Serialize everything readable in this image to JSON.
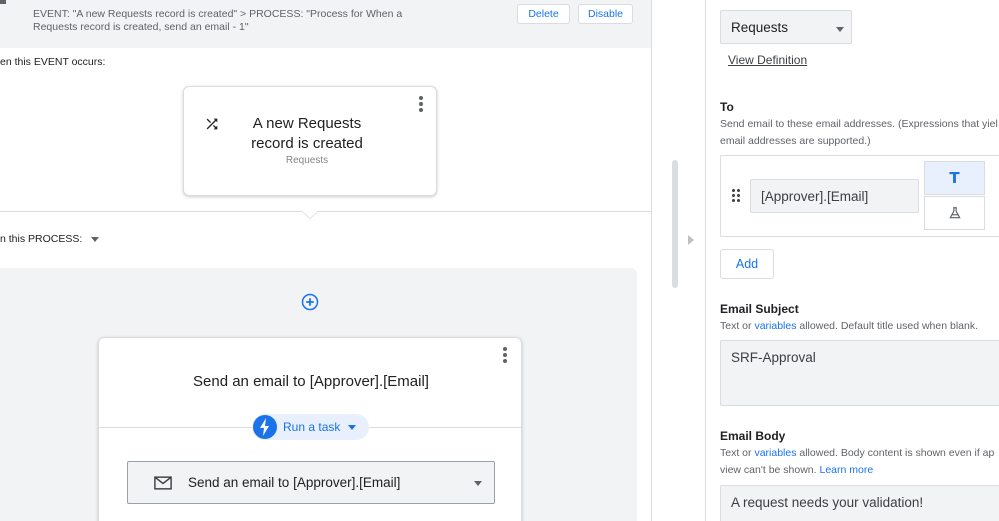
{
  "event_header": {
    "description": "EVENT: \"A new Requests record is created\" > PROCESS: \"Process for When a Requests record is created, send an email - 1\"",
    "delete_label": "Delete",
    "disable_label": "Disable"
  },
  "event_section": {
    "label": "en this EVENT occurs:",
    "card": {
      "title": "A new Requests record is created",
      "subtitle": "Requests",
      "icon": "shuffle-icon"
    }
  },
  "process_section": {
    "label": "n this PROCESS:",
    "step": {
      "title": "Send an email to [Approver].[Email]",
      "task_type_label": "Run a task",
      "task_select_label": "Send an email to [Approver].[Email]",
      "icon": "mail-icon"
    }
  },
  "settings": {
    "table_value": "Requests",
    "view_definition_label": "View Definition",
    "to": {
      "label": "To",
      "helper": "Send email to these email addresses. (Expressions that yiel",
      "helper_line2": "email addresses are supported.)",
      "entries": [
        "[Approver].[Email]"
      ],
      "mode_text_icon": "T",
      "add_label": "Add"
    },
    "subject": {
      "label": "Email Subject",
      "helper_pre": "Text or ",
      "helper_link": "variables",
      "helper_post": " allowed. Default title used when blank.",
      "value": "SRF-Approval"
    },
    "body": {
      "label": "Email Body",
      "helper_pre": "Text or ",
      "helper_link": "variables",
      "helper_post": " allowed. Body content is shown even if ap",
      "helper_line2_pre": "view can't be shown. ",
      "helper_line2_link": "Learn more",
      "value": "A request needs your validation!"
    }
  },
  "colors": {
    "accent": "#1a73e8",
    "panel_gray": "#f1f3f4",
    "border": "#dadce0"
  }
}
